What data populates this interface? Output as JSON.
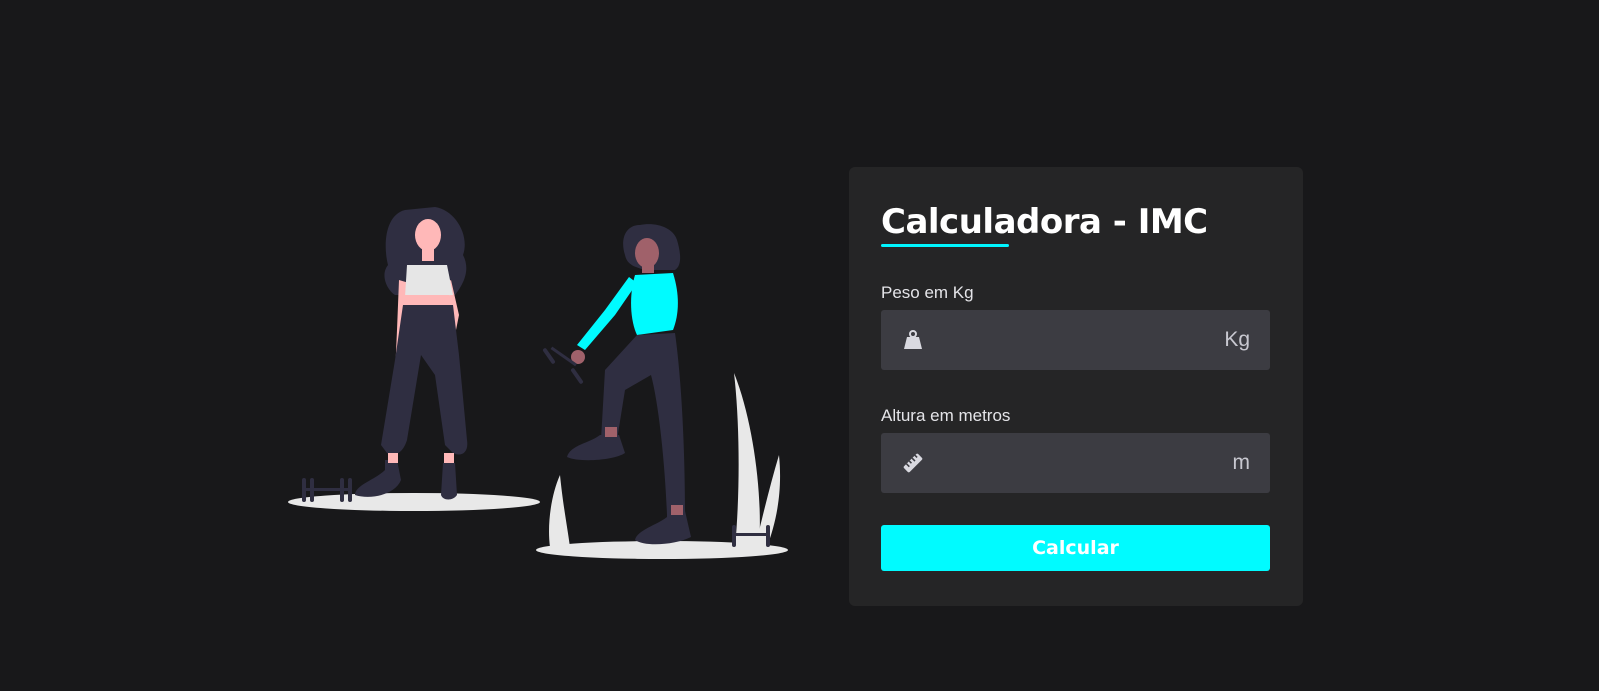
{
  "form": {
    "title": "Calculadora - IMC",
    "weight": {
      "label": "Peso em Kg",
      "value": "",
      "unit": "Kg",
      "icon": "weight-icon"
    },
    "height": {
      "label": "Altura em metros",
      "value": "",
      "unit": "m",
      "icon": "ruler-icon"
    },
    "submit_label": "Calcular"
  },
  "colors": {
    "background": "#18181a",
    "card": "#252526",
    "input": "#3c3c42",
    "accent": "#00fbff"
  }
}
